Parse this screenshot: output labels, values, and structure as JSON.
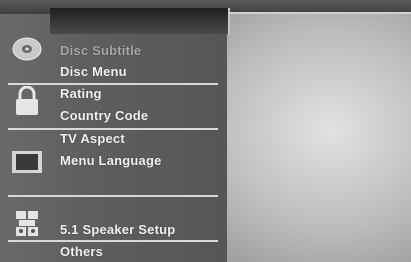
{
  "menu": {
    "items": [
      {
        "label": "Disc Subtitle",
        "state": "dimmed"
      },
      {
        "label": "Disc Menu",
        "state": "normal"
      },
      {
        "label": "Rating",
        "state": "normal"
      },
      {
        "label": "Country Code",
        "state": "normal"
      },
      {
        "label": "TV Aspect",
        "state": "normal"
      },
      {
        "label": "Menu Language",
        "state": "normal"
      },
      {
        "label": "5.1 Speaker Setup",
        "state": "normal"
      },
      {
        "label": "Others",
        "state": "normal"
      }
    ]
  },
  "icons": {
    "disc": "disc-icon",
    "lock": "lock-icon",
    "tv": "tv-icon",
    "speaker": "speaker-icon"
  },
  "colors": {
    "panel": "#5e5e5e",
    "text": "#f2f2f2",
    "dim_text": "#a9a9a9",
    "divider": "#d8d8d8"
  }
}
